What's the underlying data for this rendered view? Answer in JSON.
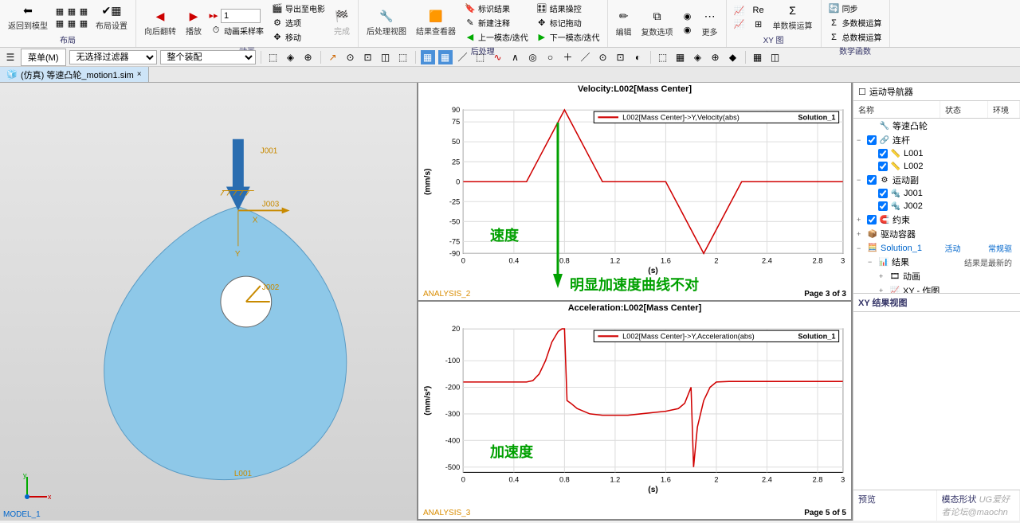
{
  "ribbon": {
    "groups": {
      "layout": {
        "label": "布局",
        "return_model": "返回到模型",
        "layout_settings": "布局设置"
      },
      "anim": {
        "label": "动画",
        "nav_back": "向后翻转",
        "play": "播放",
        "frame_value": "1",
        "export_movie": "导出至电影",
        "sample_rate": "动画采样率",
        "options": "选项",
        "move": "移动",
        "finish": "完成"
      },
      "post": {
        "label": "后处理",
        "post_view": "后处理视图",
        "result_viewer": "结果查看器",
        "mark_result": "标识结果",
        "new_annot": "新建注释",
        "prev_iter": "上一模态/迭代",
        "result_control": "结果操控",
        "mark_drag": "标记拖动",
        "next_iter": "下一模态/迭代"
      },
      "edit": {
        "label": "",
        "edit": "编辑",
        "more_opts": "复数选项",
        "more": "更多"
      },
      "xy": {
        "label": "XY 图",
        "single_calc": "单数模运算",
        "sync": "同步",
        "multi_calc": "多数模运算",
        "total_calc": "总数模运算"
      },
      "math": {
        "label": "数学函数"
      }
    }
  },
  "secondary": {
    "menu": "菜单(M)",
    "filter": "无选择过滤器",
    "assembly": "整个装配"
  },
  "tab": {
    "title": "(仿真) 等速凸轮_motion1.sim"
  },
  "viewport": {
    "label": "MODEL_1",
    "joints": {
      "j001": "J001",
      "j002": "J002",
      "j003": "J003",
      "l001": "L001"
    }
  },
  "annotations": {
    "velocity": "速度",
    "accel": "加速度",
    "wrong_curve": "明显加速度曲线不对"
  },
  "chart_data": [
    {
      "type": "line",
      "title": "Velocity:L002[Mass Center]",
      "xlabel": "(s)",
      "ylabel": "(mm/s)",
      "xlim": [
        0,
        3
      ],
      "ylim": [
        -90,
        90
      ],
      "xticks": [
        0,
        0.4,
        0.8,
        1.2,
        1.6,
        2,
        2.4,
        2.8,
        3
      ],
      "yticks": [
        -90,
        -75,
        -50,
        -25,
        0,
        25,
        50,
        75,
        90
      ],
      "series": [
        {
          "name": "L002[Mass Center]->Y,Velocity(abs)",
          "solution": "Solution_1",
          "color": "#d00000",
          "x": [
            0,
            0.1,
            0.2,
            0.3,
            0.4,
            0.5,
            0.6,
            0.7,
            0.8,
            0.9,
            1.0,
            1.1,
            1.2,
            1.3,
            1.4,
            1.5,
            1.6,
            1.7,
            1.8,
            1.9,
            2.0,
            2.1,
            2.2,
            2.3,
            2.4,
            2.5,
            2.6,
            2.7,
            2.8,
            2.9,
            3.0
          ],
          "y": [
            0,
            0,
            0,
            0,
            0,
            0,
            30,
            60,
            90,
            60,
            30,
            0,
            0,
            0,
            0,
            0,
            0,
            -30,
            -60,
            -90,
            -60,
            -30,
            0,
            0,
            0,
            0,
            0,
            0,
            0,
            0,
            0
          ]
        }
      ],
      "footer_label": "ANALYSIS_2",
      "page": "Page 3 of 3"
    },
    {
      "type": "line",
      "title": "Acceleration:L002[Mass Center]",
      "xlabel": "(s)",
      "ylabel": "(mm/s²)",
      "xlim": [
        0,
        3
      ],
      "ylim": [
        -520,
        20
      ],
      "xticks": [
        0,
        0.4,
        0.8,
        1.2,
        1.6,
        2,
        2.4,
        2.8,
        3
      ],
      "yticks": [
        -500,
        -400,
        -300,
        -200,
        -100,
        20
      ],
      "series": [
        {
          "name": "L002[Mass Center]->Y,Acceleration(abs)",
          "solution": "Solution_1",
          "color": "#d00000",
          "x": [
            0,
            0.1,
            0.2,
            0.3,
            0.4,
            0.5,
            0.55,
            0.6,
            0.65,
            0.7,
            0.75,
            0.78,
            0.8,
            0.82,
            0.85,
            0.9,
            1.0,
            1.1,
            1.2,
            1.3,
            1.4,
            1.5,
            1.6,
            1.7,
            1.75,
            1.8,
            1.82,
            1.85,
            1.9,
            1.95,
            2.0,
            2.1,
            2.2,
            2.3,
            2.4,
            2.6,
            2.8,
            3.0
          ],
          "y": [
            -180,
            -180,
            -180,
            -180,
            -180,
            -180,
            -175,
            -150,
            -100,
            -30,
            10,
            20,
            20,
            -250,
            -260,
            -280,
            -300,
            -305,
            -305,
            -305,
            -300,
            -295,
            -290,
            -280,
            -260,
            -200,
            -500,
            -350,
            -250,
            -200,
            -180,
            -178,
            -178,
            -178,
            -178,
            -178,
            -178,
            -178
          ]
        }
      ],
      "footer_label": "ANALYSIS_3",
      "page": "Page 5 of 5"
    }
  ],
  "navigator": {
    "title": "运动导航器",
    "columns": {
      "name": "名称",
      "status": "状态",
      "env": "环境"
    },
    "tree": [
      {
        "indent": 0,
        "toggle": "",
        "check": false,
        "icon": "🔧",
        "label": "等速凸轮"
      },
      {
        "indent": 0,
        "toggle": "−",
        "check": true,
        "icon": "🔗",
        "label": "连杆"
      },
      {
        "indent": 1,
        "toggle": "",
        "check": true,
        "icon": "📏",
        "label": "L001"
      },
      {
        "indent": 1,
        "toggle": "",
        "check": true,
        "icon": "📏",
        "label": "L002"
      },
      {
        "indent": 0,
        "toggle": "−",
        "check": true,
        "icon": "⚙",
        "label": "运动副"
      },
      {
        "indent": 1,
        "toggle": "",
        "check": true,
        "icon": "🔩",
        "label": "J001"
      },
      {
        "indent": 1,
        "toggle": "",
        "check": true,
        "icon": "🔩",
        "label": "J002"
      },
      {
        "indent": 0,
        "toggle": "+",
        "check": true,
        "icon": "🧲",
        "label": "约束"
      },
      {
        "indent": 0,
        "toggle": "+",
        "check": false,
        "icon": "📦",
        "label": "驱动容器"
      },
      {
        "indent": 0,
        "toggle": "−",
        "check": false,
        "icon": "🧮",
        "label": "Solution_1",
        "status": "活动",
        "env": "常规驱",
        "blue": true
      },
      {
        "indent": 1,
        "toggle": "−",
        "check": false,
        "icon": "📊",
        "label": "结果",
        "status": "结果是最新的"
      },
      {
        "indent": 2,
        "toggle": "+",
        "check": false,
        "icon": "🎞",
        "label": "动画"
      },
      {
        "indent": 2,
        "toggle": "+",
        "check": false,
        "icon": "📈",
        "label": "XY - 作图"
      }
    ],
    "xy_view": "XY 结果视图",
    "preview": "预览",
    "modal": "模态形状",
    "watermark": "UG爱好者论坛@maochn"
  }
}
